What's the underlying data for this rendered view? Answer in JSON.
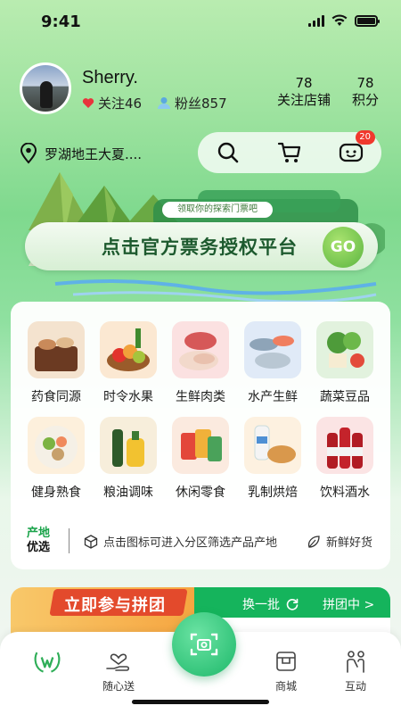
{
  "status_bar": {
    "time": "9:41"
  },
  "profile": {
    "username": "Sherry.",
    "follow_label": "关注46",
    "fans_label": "粉丝857",
    "stats": [
      {
        "num": "78",
        "label": "关注店铺"
      },
      {
        "num": "78",
        "label": "积分"
      }
    ]
  },
  "location": {
    "text": "罗湖地王大夏...."
  },
  "actions": {
    "icons": [
      "search-icon",
      "cart-icon",
      "message-icon"
    ],
    "message_badge": "20"
  },
  "banner": {
    "tag": "领取你的探索门票吧",
    "title": "点击官方票务授权平台",
    "go_label": "GO"
  },
  "categories": [
    {
      "label": "药食同源",
      "icon": "herbal-icon",
      "color": "#f4e3cf"
    },
    {
      "label": "时令水果",
      "icon": "fruit-icon",
      "color": "#fbe8d2"
    },
    {
      "label": "生鲜肉类",
      "icon": "meat-icon",
      "color": "#fbe1e1"
    },
    {
      "label": "水产生鲜",
      "icon": "seafood-icon",
      "color": "#e0eaf7"
    },
    {
      "label": "蔬菜豆品",
      "icon": "vegetable-icon",
      "color": "#e2f2de"
    },
    {
      "label": "健身熟食",
      "icon": "salad-icon",
      "color": "#fdf0dc"
    },
    {
      "label": "粮油调味",
      "icon": "oil-icon",
      "color": "#f7eedb"
    },
    {
      "label": "休闲零食",
      "icon": "snack-icon",
      "color": "#fbeadf"
    },
    {
      "label": "乳制烘焙",
      "icon": "bakery-icon",
      "color": "#fdf1e0"
    },
    {
      "label": "饮料酒水",
      "icon": "drink-icon",
      "color": "#fbe4e4"
    }
  ],
  "origin": {
    "title_line1": "产地",
    "title_line2": "优选",
    "hint": "点击图标可进入分区筛选产品产地",
    "fresh": "新鲜好货"
  },
  "group_buy": {
    "title": "立即参与拼团",
    "change": "换一批",
    "ongoing": "拼团中 >"
  },
  "tabbar": {
    "tabs": [
      {
        "label": "",
        "icon": "home-logo-icon"
      },
      {
        "label": "随心送",
        "icon": "delivery-icon"
      },
      {
        "label": "商城",
        "icon": "store-icon"
      },
      {
        "label": "互动",
        "icon": "community-icon"
      }
    ],
    "center_icon": "scan-icon"
  },
  "colors": {
    "brand": "#1db86a",
    "badge": "#f0382d",
    "accent_green": "#15b45c"
  }
}
